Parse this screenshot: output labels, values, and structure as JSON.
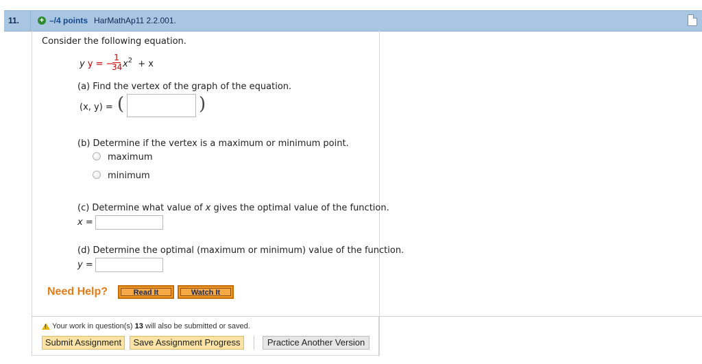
{
  "header": {
    "question_number": "11.",
    "points": "–/4 points",
    "question_id": "HarMathAp11 2.2.001."
  },
  "intro": "Consider the following equation.",
  "equation": {
    "lhs": "y = −",
    "numerator": "1",
    "denominator": "34",
    "var": "x",
    "exponent": "2",
    "rest": "+ x"
  },
  "part_a": {
    "text": "(a) Find the vertex of the graph of the equation.",
    "answer_label": "(x, y) =",
    "value": ""
  },
  "part_b": {
    "text": "(b) Determine if the vertex is a maximum or minimum point.",
    "options": [
      "maximum",
      "minimum"
    ]
  },
  "part_c": {
    "prefix": "(c) Determine what value of ",
    "var": "x",
    "suffix": " gives the optimal value of the function.",
    "answer_label": "x =",
    "value": ""
  },
  "part_d": {
    "text": "(d) Determine the optimal (maximum or minimum) value of the function.",
    "answer_label": "y =",
    "value": ""
  },
  "help": {
    "label": "Need Help?",
    "read_it": "Read It",
    "watch_it": "Watch It"
  },
  "footer": {
    "warning_prefix": "Your work in question(s) ",
    "warning_question": "13",
    "warning_suffix": " will also be submitted or saved.",
    "submit": "Submit Assignment",
    "save": "Save Assignment Progress",
    "practice": "Practice Another Version"
  },
  "colors": {
    "header_bg": "#a8c6e2",
    "help_orange": "#e47d18",
    "fraction_red": "#cc0000"
  }
}
